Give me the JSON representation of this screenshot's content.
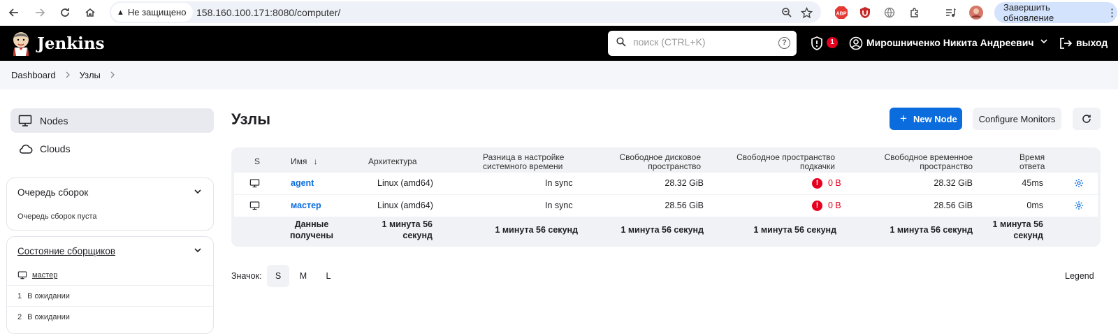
{
  "browser": {
    "security_label": "Не защищено",
    "url": "158.160.100.171:8080/computer/",
    "update_button": "Завершить обновление"
  },
  "header": {
    "brand": "Jenkins",
    "search_placeholder": "поиск (CTRL+K)",
    "security_badge_count": "1",
    "user_name": "Мирошниченко Никита Андреевич",
    "logout": "выход"
  },
  "breadcrumb": [
    "Dashboard",
    "Узлы"
  ],
  "sidebar": {
    "items": [
      {
        "label": "Nodes",
        "icon": "computer-icon"
      },
      {
        "label": "Clouds",
        "icon": "cloud-icon"
      }
    ],
    "build_queue": {
      "title": "Очередь сборок",
      "empty_text": "Очередь сборок пуста"
    },
    "executors": {
      "title": "Состояние сборщиков",
      "node": "мастер",
      "rows": [
        {
          "num": "1",
          "status": "В ожидании"
        },
        {
          "num": "2",
          "status": "В ожидании"
        }
      ]
    }
  },
  "main": {
    "title": "Узлы",
    "new_node": "New Node",
    "configure_monitors": "Configure Monitors",
    "table": {
      "headers": {
        "s": "S",
        "name": "Имя",
        "sort": "↓",
        "arch": "Архитектура",
        "clock1": "Разница в настройке",
        "clock2": "системного времени",
        "disk1": "Свободное дисковое",
        "disk2": "пространство",
        "swap1": "Свободное пространство",
        "swap2": "подкачки",
        "temp1": "Свободное временное",
        "temp2": "пространство",
        "resp1": "Время",
        "resp2": "ответа"
      },
      "rows": [
        {
          "name": "agent",
          "arch": "Linux (amd64)",
          "clock": "In sync",
          "disk": "28.32 GiB",
          "swap": "0 B",
          "temp": "28.32 GiB",
          "response": "45ms"
        },
        {
          "name": "мастер",
          "arch": "Linux (amd64)",
          "clock": "In sync",
          "disk": "28.56 GiB",
          "swap": "0 B",
          "temp": "28.56 GiB",
          "response": "0ms"
        }
      ],
      "footer": {
        "label1": "Данные",
        "label2": "получены",
        "arch1": "1 минута 56",
        "arch2": "секунд",
        "clock": "1 минута 56 секунд",
        "disk": "1 минута 56 секунд",
        "swap": "1 минута 56 секунд",
        "temp": "1 минута 56 секунд",
        "resp1": "1 минута 56",
        "resp2": "секунд"
      }
    },
    "icon_size_label": "Значок:",
    "sizes": [
      "S",
      "M",
      "L"
    ],
    "selected_size": "S",
    "legend": "Legend"
  },
  "colors": {
    "accent": "#0b6cde",
    "error": "#e6001f",
    "header_bg": "#000000"
  }
}
